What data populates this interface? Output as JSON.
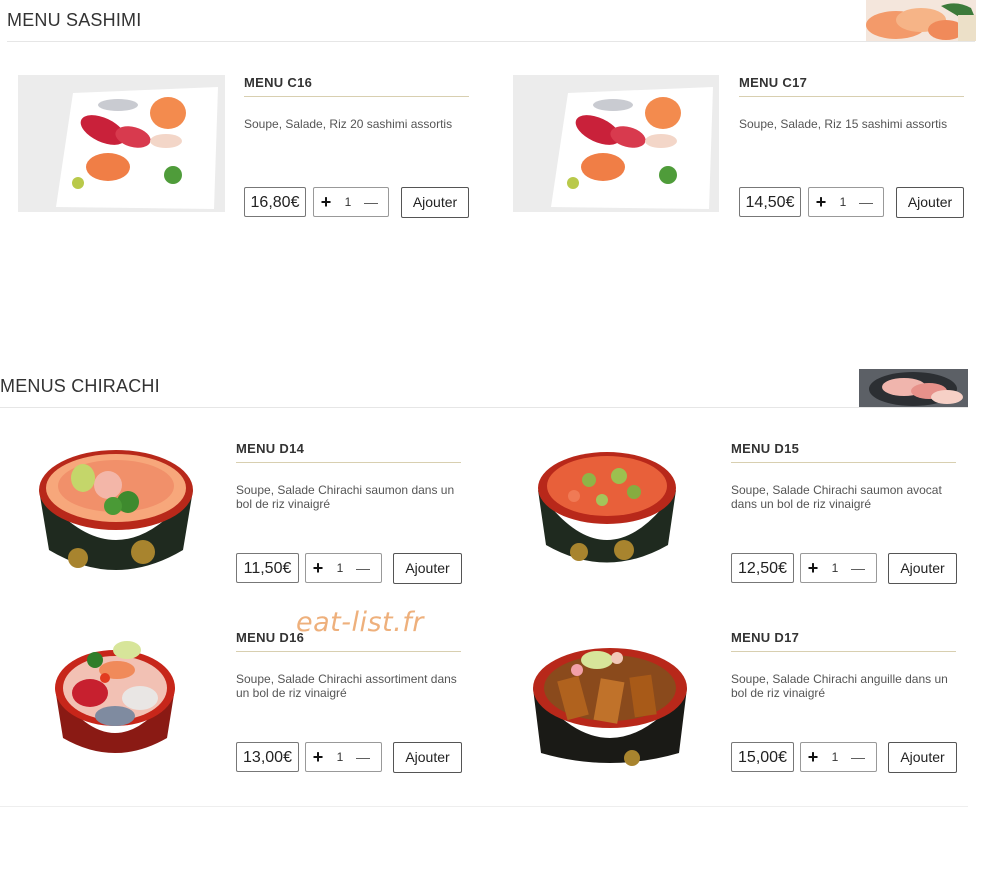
{
  "sections": [
    {
      "title": "MENU SASHIMI"
    },
    {
      "title": "MENUS CHIRACHI"
    }
  ],
  "products": [
    {
      "name": "MENU C16",
      "description": "Soupe, Salade, Riz 20 sashimi assortis",
      "price": "16,80€",
      "qty": "1",
      "add_label": "Ajouter"
    },
    {
      "name": "MENU C17",
      "description": "Soupe, Salade, Riz 15 sashimi assortis",
      "price": "14,50€",
      "qty": "1",
      "add_label": "Ajouter"
    },
    {
      "name": "MENU D14",
      "description": "Soupe, Salade Chirachi saumon dans un bol de riz vinaigré",
      "price": "11,50€",
      "qty": "1",
      "add_label": "Ajouter"
    },
    {
      "name": "MENU D15",
      "description": "Soupe, Salade Chirachi saumon avocat dans un bol de riz vinaigré",
      "price": "12,50€",
      "qty": "1",
      "add_label": "Ajouter"
    },
    {
      "name": "MENU D16",
      "description": "Soupe, Salade Chirachi assortiment dans un bol de riz vinaigré",
      "price": "13,00€",
      "qty": "1",
      "add_label": "Ajouter"
    },
    {
      "name": "MENU D17",
      "description": "Soupe, Salade Chirachi anguille dans un bol de riz vinaigré",
      "price": "15,00€",
      "qty": "1",
      "add_label": "Ajouter"
    }
  ],
  "controls": {
    "plus_symbol": "+",
    "minus_symbol": "—"
  },
  "watermark": "eat-list.fr",
  "icons": {
    "plus": "plus-icon",
    "minus": "minus-icon"
  },
  "colors": {
    "divider": "#d8cfb0",
    "watermark": "#e8965a"
  }
}
